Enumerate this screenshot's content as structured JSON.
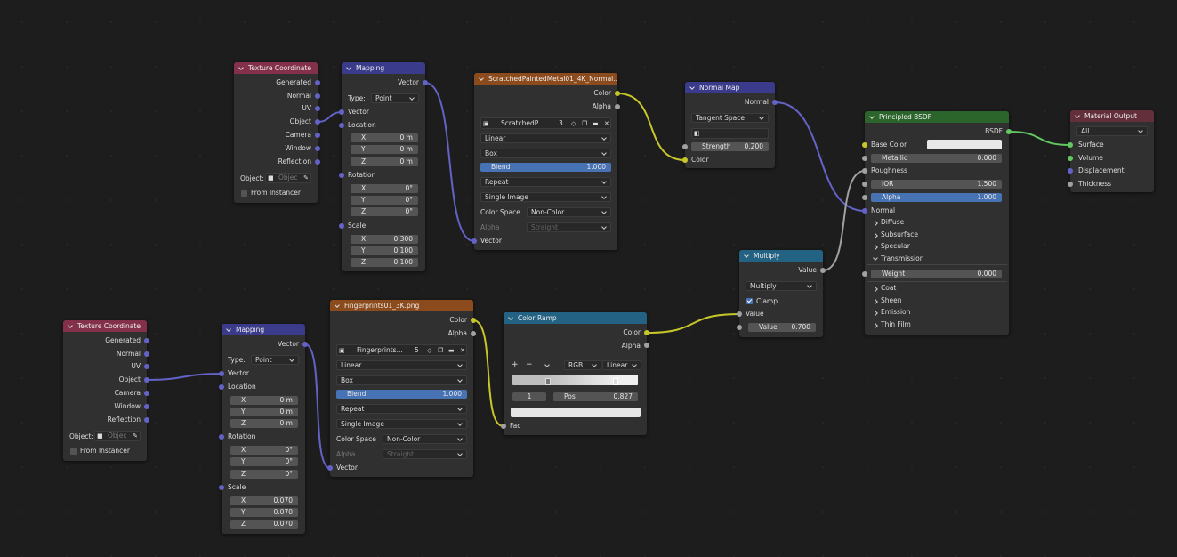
{
  "colors": {
    "vector_socket": "#6363c7",
    "float_socket": "#a1a1a1",
    "color_socket": "#c7c729",
    "shader_socket": "#63c763",
    "field_accent": "#4772b3"
  },
  "tc1": {
    "title": "Texture Coordinate",
    "outputs": [
      "Generated",
      "Normal",
      "UV",
      "Object",
      "Camera",
      "Window",
      "Reflection"
    ],
    "object_label": "Object:",
    "object_placeholder": "Objec",
    "from_instancer": "From Instancer"
  },
  "map1": {
    "title": "Mapping",
    "vector_out": "Vector",
    "type_label": "Type:",
    "type_value": "Point",
    "vector_in": "Vector",
    "location": "Location",
    "rotation": "Rotation",
    "scale": "Scale",
    "loc": [
      {
        "axis": "X",
        "value": "0 m"
      },
      {
        "axis": "Y",
        "value": "0 m"
      },
      {
        "axis": "Z",
        "value": "0 m"
      }
    ],
    "rot": [
      {
        "axis": "X",
        "value": "0°"
      },
      {
        "axis": "Y",
        "value": "0°"
      },
      {
        "axis": "Z",
        "value": "0°"
      }
    ],
    "scl": [
      {
        "axis": "X",
        "value": "0.300"
      },
      {
        "axis": "Y",
        "value": "0.100"
      },
      {
        "axis": "Z",
        "value": "0.100"
      }
    ]
  },
  "img1": {
    "title": "ScratchedPaintedMetal01_4K_Normal....",
    "out_color": "Color",
    "out_alpha": "Alpha",
    "image_name": "ScratchedP...",
    "users": "3",
    "interp": "Linear",
    "projection": "Box",
    "blend_label": "Blend",
    "blend_value": "1.000",
    "extension": "Repeat",
    "source": "Single Image",
    "cs_label": "Color Space",
    "cs_value": "Non-Color",
    "alpha_label": "Alpha",
    "alpha_value": "Straight",
    "vector_in": "Vector"
  },
  "nmap": {
    "title": "Normal Map",
    "out_normal": "Normal",
    "space": "Tangent Space",
    "strength_label": "Strength",
    "strength_value": "0.200",
    "color_in": "Color"
  },
  "bsdf": {
    "title": "Principled BSDF",
    "out": "BSDF",
    "base_color": "Base Color",
    "metallic_label": "Metallic",
    "metallic_value": "0.000",
    "roughness": "Roughness",
    "ior_label": "IOR",
    "ior_value": "1.500",
    "alpha_label": "Alpha",
    "alpha_value": "1.000",
    "normal": "Normal",
    "panels1": [
      "Diffuse",
      "Subsurface",
      "Specular"
    ],
    "transmission": "Transmission",
    "weight_label": "Weight",
    "weight_value": "0.000",
    "panels2": [
      "Coat",
      "Sheen",
      "Emission",
      "Thin Film"
    ]
  },
  "mout": {
    "title": "Material Output",
    "target": "All",
    "inputs": [
      "Surface",
      "Volume",
      "Displacement",
      "Thickness"
    ]
  },
  "mult": {
    "title": "Multiply",
    "out": "Value",
    "operation": "Multiply",
    "clamp": "Clamp",
    "value_in": "Value",
    "value_label": "Value",
    "value_value": "0.700"
  },
  "tc2": {
    "title": "Texture Coordinate",
    "outputs": [
      "Generated",
      "Normal",
      "UV",
      "Object",
      "Camera",
      "Window",
      "Reflection"
    ],
    "object_label": "Object:",
    "object_placeholder": "Objec",
    "from_instancer": "From Instancer"
  },
  "map2": {
    "title": "Mapping",
    "vector_out": "Vector",
    "type_label": "Type:",
    "type_value": "Point",
    "vector_in": "Vector",
    "location": "Location",
    "rotation": "Rotation",
    "scale": "Scale",
    "loc": [
      {
        "axis": "X",
        "value": "0 m"
      },
      {
        "axis": "Y",
        "value": "0 m"
      },
      {
        "axis": "Z",
        "value": "0 m"
      }
    ],
    "rot": [
      {
        "axis": "X",
        "value": "0°"
      },
      {
        "axis": "Y",
        "value": "0°"
      },
      {
        "axis": "Z",
        "value": "0°"
      }
    ],
    "scl": [
      {
        "axis": "X",
        "value": "0.070"
      },
      {
        "axis": "Y",
        "value": "0.070"
      },
      {
        "axis": "Z",
        "value": "0.070"
      }
    ]
  },
  "img2": {
    "title": "Fingerprints01_3K.png",
    "out_color": "Color",
    "out_alpha": "Alpha",
    "image_name": "Fingerprints...",
    "users": "5",
    "interp": "Linear",
    "projection": "Box",
    "blend_label": "Blend",
    "blend_value": "1.000",
    "extension": "Repeat",
    "source": "Single Image",
    "cs_label": "Color Space",
    "cs_value": "Non-Color",
    "alpha_label": "Alpha",
    "alpha_value": "Straight",
    "vector_in": "Vector"
  },
  "ramp": {
    "title": "Color Ramp",
    "out_color": "Color",
    "out_alpha": "Alpha",
    "mode": "RGB",
    "interp": "Linear",
    "index": "1",
    "pos_label": "Pos",
    "pos_value": "0.827",
    "fac_in": "Fac"
  }
}
